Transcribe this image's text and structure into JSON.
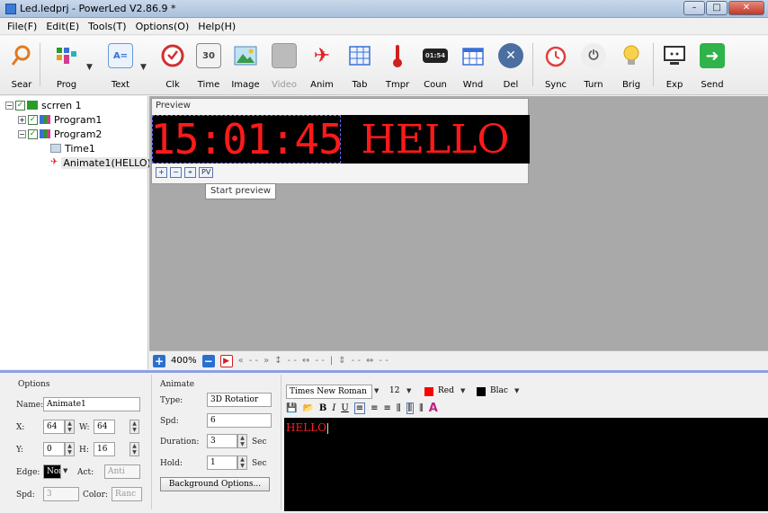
{
  "window": {
    "title": "Led.ledprj - PowerLed V2.86.9 *",
    "min": "–",
    "max": "□",
    "close": "✕"
  },
  "menu": [
    "File(F)",
    "Edit(E)",
    "Tools(T)",
    "Options(O)",
    "Help(H)"
  ],
  "toolbar": {
    "items": [
      {
        "label": "Sear",
        "icon": "magnifier-icon"
      },
      {
        "label": "Prog",
        "icon": "program-icon"
      },
      {
        "label": "Text",
        "icon": "text-icon"
      },
      {
        "label": "Clk",
        "icon": "clock-icon"
      },
      {
        "label": "Time",
        "icon": "calendar-icon",
        "icon_text": "30"
      },
      {
        "label": "Image",
        "icon": "image-icon"
      },
      {
        "label": "Video",
        "icon": "video-icon",
        "disabled": true
      },
      {
        "label": "Anim",
        "icon": "animation-icon"
      },
      {
        "label": "Tab",
        "icon": "table-icon"
      },
      {
        "label": "Tmpr",
        "icon": "thermometer-icon"
      },
      {
        "label": "Coun",
        "icon": "counter-icon",
        "icon_text": "01:54"
      },
      {
        "label": "Wnd",
        "icon": "window-icon"
      },
      {
        "label": "Del",
        "icon": "delete-icon"
      },
      {
        "label": "Sync",
        "icon": "alarm-clock-icon"
      },
      {
        "label": "Turn",
        "icon": "power-icon"
      },
      {
        "label": "Brig",
        "icon": "bulb-icon"
      },
      {
        "label": "Exp",
        "icon": "export-icon"
      },
      {
        "label": "Send",
        "icon": "send-arrow-icon"
      }
    ]
  },
  "tree": {
    "root": "scrren 1",
    "program1": "Program1",
    "program2": "Program2",
    "time1": "Time1",
    "animate1": "Animate1(HELLO)"
  },
  "preview": {
    "title": "Preview",
    "clock_text": "15:01:45",
    "hello_text": "HELLO",
    "ctrl_plus": "+",
    "ctrl_minus": "−",
    "ctrl_fit": "⌖",
    "ctrl_pv": "PV",
    "tooltip": "Start preview"
  },
  "zoom": {
    "level": "400%",
    "dash1": "- -",
    "dash2": "- -",
    "dash3": "- -",
    "dash4": "- -",
    "dash5": "- -"
  },
  "options": {
    "title": "Options",
    "name_label": "Name:",
    "name_value": "Animate1",
    "x_label": "X:",
    "x_value": "64",
    "w_label": "W:",
    "w_value": "64",
    "y_label": "Y:",
    "y_value": "0",
    "h_label": "H:",
    "h_value": "16",
    "edge_label": "Edge:",
    "edge_value": "Non",
    "act_label": "Act:",
    "act_value": "Anti",
    "spd_label": "Spd:",
    "spd_value": "3",
    "color_label": "Color:",
    "color_value": "Ranc"
  },
  "animate": {
    "title": "Animate",
    "type_label": "Type:",
    "type_value": "3D Rotatior",
    "spd_label": "Spd:",
    "spd_value": "6",
    "duration_label": "Duration:",
    "duration_value": "3",
    "duration_unit": "Sec",
    "hold_label": "Hold:",
    "hold_value": "1",
    "hold_unit": "Sec",
    "bg_button": "Background Options..."
  },
  "format": {
    "font": "Times New Roman",
    "size": "12",
    "fg_color_name": "Red",
    "fg_color": "#ff0000",
    "bg_color_name": "Blac",
    "bg_color": "#000000",
    "bold": "B",
    "italic": "I",
    "underline": "U",
    "big_a": "A"
  },
  "editor": {
    "text": "HELLO"
  }
}
